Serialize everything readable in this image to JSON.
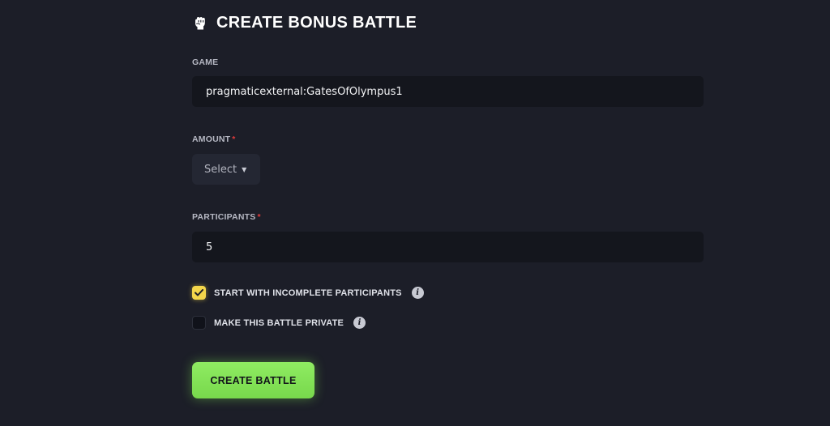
{
  "header": {
    "title": "CREATE BONUS BATTLE",
    "icon": "fist-icon"
  },
  "form": {
    "game": {
      "label": "GAME",
      "value": "pragmaticexternal:GatesOfOlympus1"
    },
    "amount": {
      "label": "AMOUNT",
      "required_mark": "*",
      "selected": "Select",
      "caret": "▼"
    },
    "participants": {
      "label": "PARTICIPANTS",
      "required_mark": "*",
      "value": "5"
    },
    "options": [
      {
        "label": "START WITH INCOMPLETE PARTICIPANTS",
        "checked": true,
        "info": "i"
      },
      {
        "label": "MAKE THIS BATTLE PRIVATE",
        "checked": false,
        "info": "i"
      }
    ],
    "submit_label": "CREATE BATTLE"
  },
  "colors": {
    "background": "#1c1e28",
    "input_bg": "#14161d",
    "select_bg": "#242733",
    "required": "#e03b3b",
    "checkbox_checked": "#f3d64b",
    "button": "#86e55a"
  }
}
